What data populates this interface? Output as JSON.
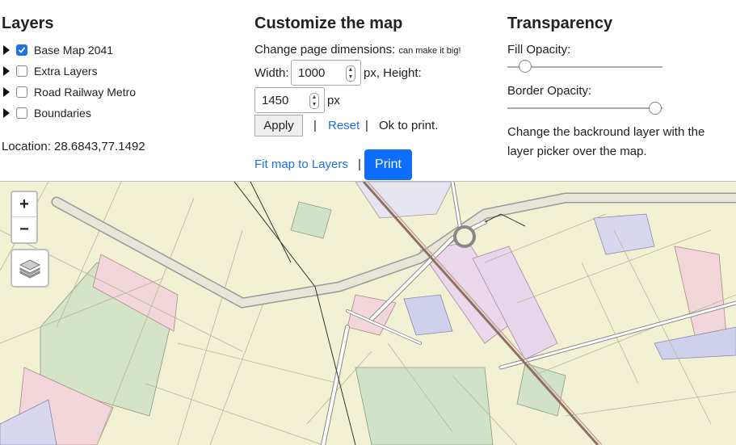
{
  "layers": {
    "title": "Layers",
    "items": [
      {
        "label": "Base Map 2041",
        "checked": true
      },
      {
        "label": "Extra Layers",
        "checked": false
      },
      {
        "label": "Road Railway Metro",
        "checked": false
      },
      {
        "label": "Boundaries",
        "checked": false
      }
    ],
    "location_label": "Location: 28.6843,77.1492"
  },
  "customize": {
    "title": "Customize the map",
    "change_dims": "Change page dimensions:",
    "make_big": "can make it big!",
    "width_label": "Width:",
    "width_value": "1000",
    "px_height": "px, Height:",
    "height_value": "1450",
    "px": "px",
    "apply": "Apply",
    "sep": "|",
    "reset": "Reset",
    "ok_sep": "|",
    "ok_text": "Ok to print.",
    "fit": "Fit map to Layers",
    "fit_sep": "|",
    "print": "Print"
  },
  "transparency": {
    "title": "Transparency",
    "fill_label": "Fill Opacity:",
    "fill_value": 0.1,
    "border_label": "Border Opacity:",
    "border_value": 1.0,
    "help": "Change the backround layer with the",
    "help2": "layer picker over the map."
  },
  "map": {
    "zoom_in": "+",
    "zoom_out": "−"
  },
  "colors": {
    "accent": "#1a73e8",
    "print_bg": "#0d6efd",
    "map_bg": "#f3f1d3"
  }
}
